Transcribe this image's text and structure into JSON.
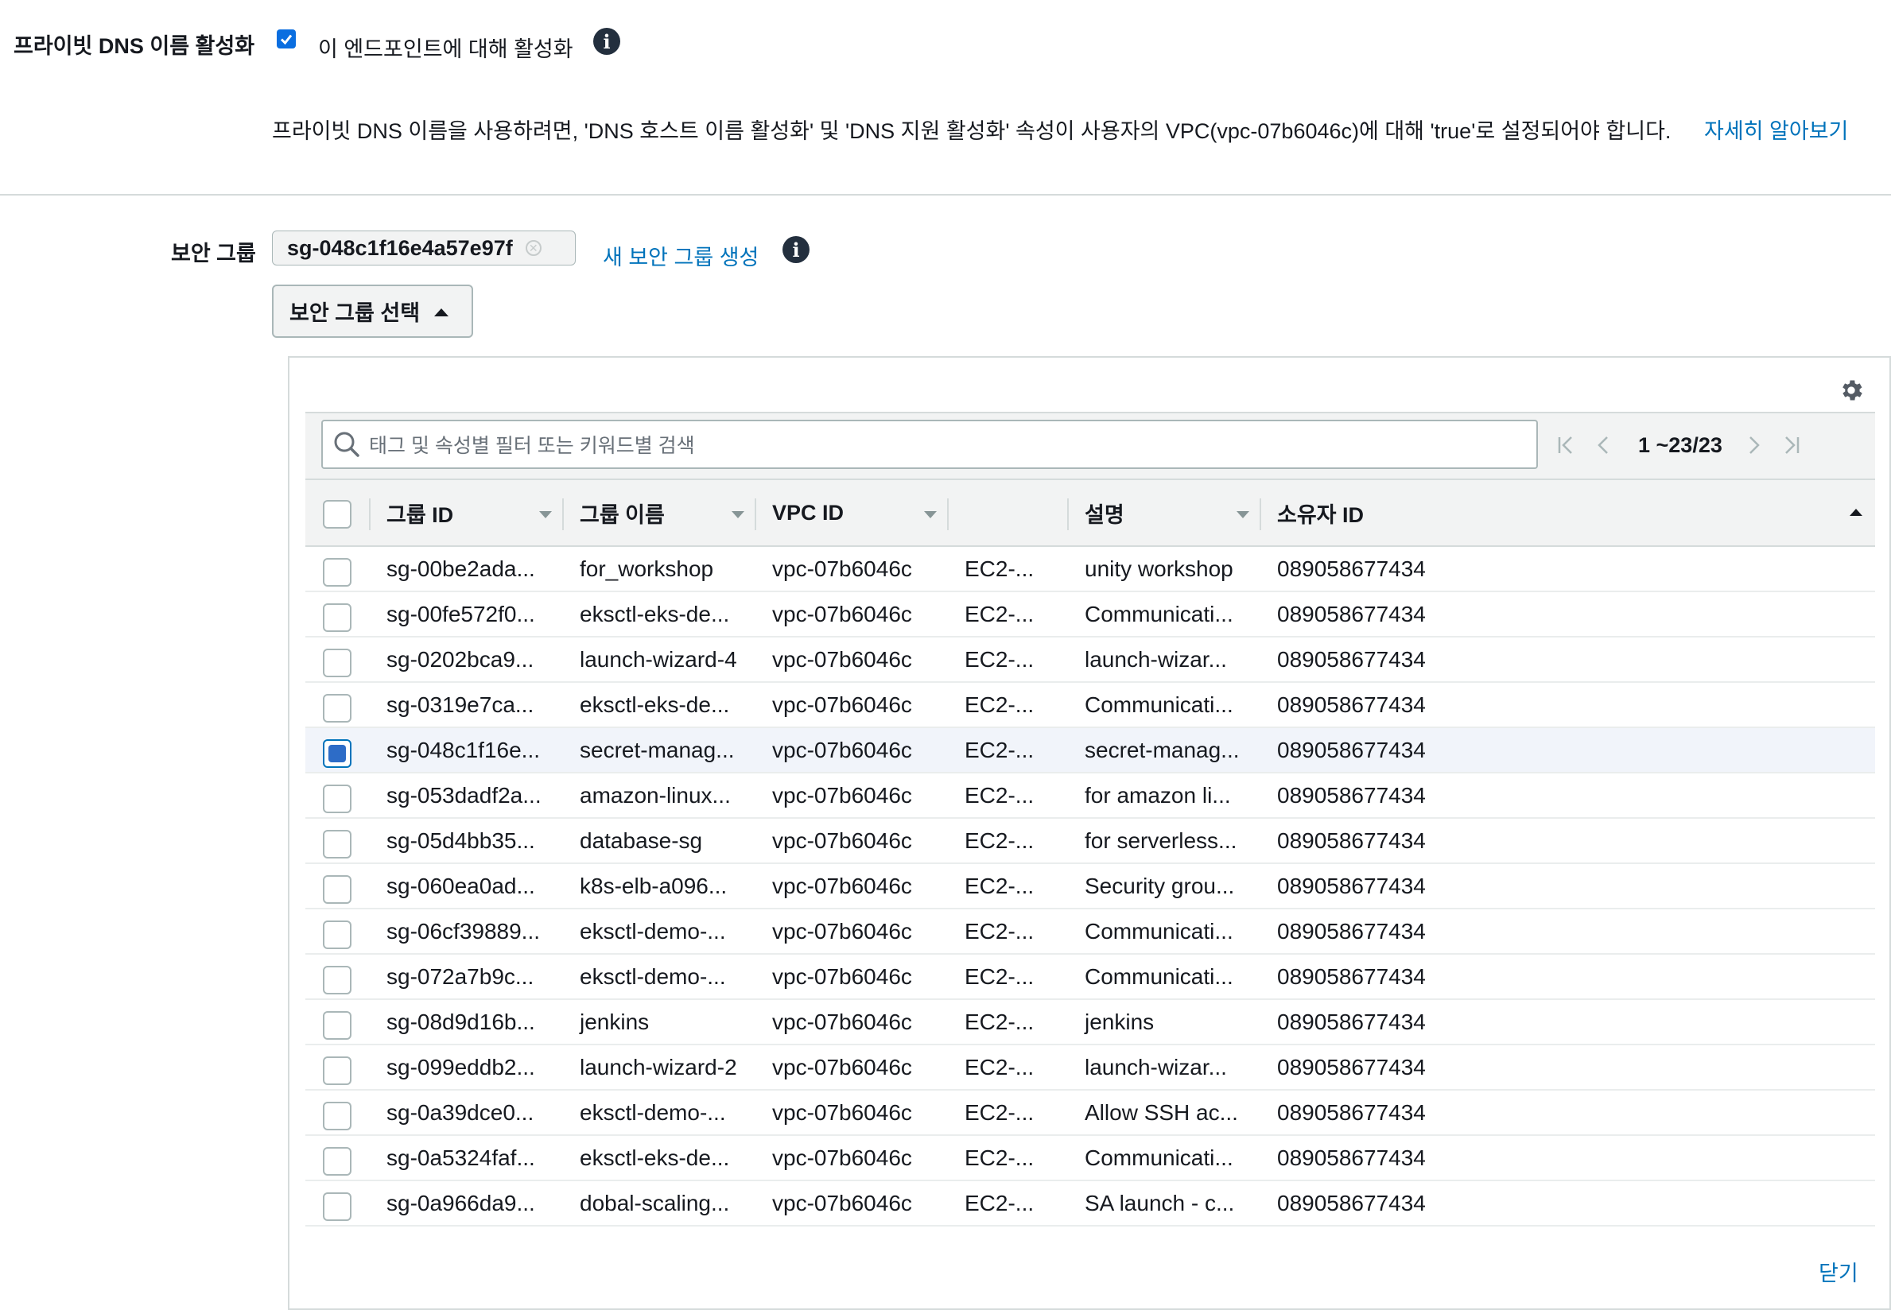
{
  "private_dns": {
    "label": "프라이빗 DNS 이름 활성화",
    "checkbox_label": "이 엔드포인트에 대해 활성화",
    "checked": true,
    "info_icon": "info-icon",
    "note": "프라이빗 DNS 이름을 사용하려면, 'DNS 호스트 이름 활성화' 및 'DNS 지원 활성화' 속성이 사용자의 VPC(vpc-07b6046c)에 대해 'true'로 설정되어야 합니다.",
    "learn_more": "자세히 알아보기"
  },
  "security_group": {
    "label": "보안 그룹",
    "token": "sg-048c1f16e4a57e97f",
    "create_link": "새 보안 그룹 생성",
    "select_button": "보안 그룹 선택"
  },
  "table": {
    "settings_icon": "gear-icon",
    "search_placeholder": "태그 및 속성별 필터 또는 키워드별 검색",
    "pagination": "1 ~23/23",
    "columns": [
      "그룹 ID",
      "그룹 이름",
      "VPC ID",
      "",
      "설명",
      "소유자 ID"
    ],
    "rows": [
      {
        "id": "sg-00be2ada...",
        "name": "for_workshop",
        "vpc": "vpc-07b6046c",
        "type": "EC2-...",
        "desc": "unity workshop",
        "owner": "089058677434",
        "selected": false
      },
      {
        "id": "sg-00fe572f0...",
        "name": "eksctl-eks-de...",
        "vpc": "vpc-07b6046c",
        "type": "EC2-...",
        "desc": "Communicati...",
        "owner": "089058677434",
        "selected": false
      },
      {
        "id": "sg-0202bca9...",
        "name": "launch-wizard-4",
        "vpc": "vpc-07b6046c",
        "type": "EC2-...",
        "desc": "launch-wizar...",
        "owner": "089058677434",
        "selected": false
      },
      {
        "id": "sg-0319e7ca...",
        "name": "eksctl-eks-de...",
        "vpc": "vpc-07b6046c",
        "type": "EC2-...",
        "desc": "Communicati...",
        "owner": "089058677434",
        "selected": false
      },
      {
        "id": "sg-048c1f16e...",
        "name": "secret-manag...",
        "vpc": "vpc-07b6046c",
        "type": "EC2-...",
        "desc": "secret-manag...",
        "owner": "089058677434",
        "selected": true
      },
      {
        "id": "sg-053dadf2a...",
        "name": "amazon-linux...",
        "vpc": "vpc-07b6046c",
        "type": "EC2-...",
        "desc": "for amazon li...",
        "owner": "089058677434",
        "selected": false
      },
      {
        "id": "sg-05d4bb35...",
        "name": "database-sg",
        "vpc": "vpc-07b6046c",
        "type": "EC2-...",
        "desc": "for serverless...",
        "owner": "089058677434",
        "selected": false
      },
      {
        "id": "sg-060ea0ad...",
        "name": "k8s-elb-a096...",
        "vpc": "vpc-07b6046c",
        "type": "EC2-...",
        "desc": "Security grou...",
        "owner": "089058677434",
        "selected": false
      },
      {
        "id": "sg-06cf39889...",
        "name": "eksctl-demo-...",
        "vpc": "vpc-07b6046c",
        "type": "EC2-...",
        "desc": "Communicati...",
        "owner": "089058677434",
        "selected": false
      },
      {
        "id": "sg-072a7b9c...",
        "name": "eksctl-demo-...",
        "vpc": "vpc-07b6046c",
        "type": "EC2-...",
        "desc": "Communicati...",
        "owner": "089058677434",
        "selected": false
      },
      {
        "id": "sg-08d9d16b...",
        "name": "jenkins",
        "vpc": "vpc-07b6046c",
        "type": "EC2-...",
        "desc": "jenkins",
        "owner": "089058677434",
        "selected": false
      },
      {
        "id": "sg-099eddb2...",
        "name": "launch-wizard-2",
        "vpc": "vpc-07b6046c",
        "type": "EC2-...",
        "desc": "launch-wizar...",
        "owner": "089058677434",
        "selected": false
      },
      {
        "id": "sg-0a39dce0...",
        "name": "eksctl-demo-...",
        "vpc": "vpc-07b6046c",
        "type": "EC2-...",
        "desc": "Allow SSH ac...",
        "owner": "089058677434",
        "selected": false
      },
      {
        "id": "sg-0a5324faf...",
        "name": "eksctl-eks-de...",
        "vpc": "vpc-07b6046c",
        "type": "EC2-...",
        "desc": "Communicati...",
        "owner": "089058677434",
        "selected": false
      },
      {
        "id": "sg-0a966da9...",
        "name": "dobal-scaling...",
        "vpc": "vpc-07b6046c",
        "type": "EC2-...",
        "desc": "SA launch - c...",
        "owner": "089058677434",
        "selected": false
      }
    ],
    "close": "닫기"
  },
  "colors": {
    "link": "#0073bb",
    "selected_row": "#f1f4fa",
    "checkbox_fill": "#2d6cc7",
    "header_bg": "#f2f3f3"
  }
}
